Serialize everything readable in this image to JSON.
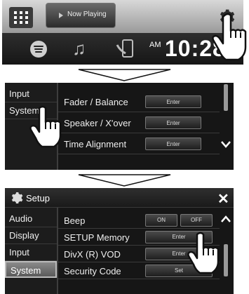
{
  "panel1": {
    "now_playing_label": "Now Playing",
    "clock_ampm": "AM",
    "clock_time": "10:28",
    "icons": [
      "app-grid-icon",
      "gear-icon",
      "spotify-icon",
      "music-note-icon",
      "phone-icon"
    ]
  },
  "panel2": {
    "sidebar": [
      "Input",
      "System"
    ],
    "rows": [
      {
        "label": "Fader / Balance",
        "button": "Enter"
      },
      {
        "label": "Speaker / X'over",
        "button": "Enter"
      },
      {
        "label": "Time Alignment",
        "button": "Enter"
      }
    ]
  },
  "panel3": {
    "title": "Setup",
    "close": "✕",
    "sidebar": [
      "Audio",
      "Display",
      "Input",
      "System"
    ],
    "active_sidebar": "System",
    "rows": [
      {
        "label": "Beep",
        "buttons": [
          "ON",
          "OFF"
        ]
      },
      {
        "label": "SETUP Memory",
        "buttons": [
          "Enter"
        ]
      },
      {
        "label": "DivX (R) VOD",
        "buttons": [
          "Enter"
        ]
      },
      {
        "label": "Security Code",
        "buttons": [
          "Set"
        ]
      }
    ]
  },
  "colors": {
    "panel_bg": "#161616",
    "active_item": "#7a7a7a",
    "accent": "#ffffff"
  }
}
